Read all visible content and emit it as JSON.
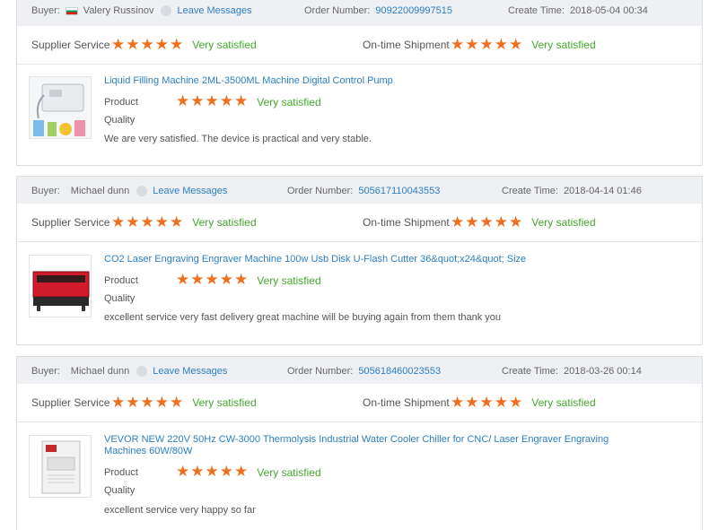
{
  "labels": {
    "buyer": "Buyer:",
    "leave_messages": "Leave Messages",
    "order_number": "Order Number:",
    "create_time": "Create Time:",
    "supplier_service": "Supplier Service",
    "ontime_shipment": "On-time Shipment",
    "product": "Product",
    "quality": "Quality",
    "very_satisfied": "Very satisfied"
  },
  "colors": {
    "star": "#f06f1e",
    "satisfied": "#43a82b",
    "link": "#2b7fc3",
    "header_bg": "#eef0f4"
  },
  "reviews": [
    {
      "buyer_name": "Valery Russinov",
      "buyer_badge_icon": "bulgaria-flag-icon",
      "order_number": "90922009997515",
      "create_time": "2018-05-04 00:34",
      "supplier_service_stars": 5,
      "ontime_shipment_stars": 5,
      "product_title": "Liquid Filling Machine 2ML-3500ML Machine Digital Control Pump",
      "product_stars": 5,
      "thumbnail_icon": "liquid-filling-machine-thumbnail",
      "comment": "We are very satisfied. The device is practical and very stable."
    },
    {
      "buyer_name": "Michael dunn",
      "buyer_badge_icon": "avatar-dot-icon",
      "order_number": "505617110043553",
      "create_time": "2018-04-14 01:46",
      "supplier_service_stars": 5,
      "ontime_shipment_stars": 5,
      "product_title": "CO2 Laser Engraving Engraver Machine 100w Usb Disk U-Flash Cutter 36&quot;x24&quot; Size",
      "product_stars": 5,
      "thumbnail_icon": "laser-engraver-thumbnail",
      "comment": "excellent service very fast delivery great machine will be buying again from them thank you"
    },
    {
      "buyer_name": "Michael dunn",
      "buyer_badge_icon": "avatar-dot-icon",
      "order_number": "505618460023553",
      "create_time": "2018-03-26 00:14",
      "supplier_service_stars": 5,
      "ontime_shipment_stars": 5,
      "product_title": "VEVOR NEW 220V 50Hz CW-3000 Thermolysis Industrial Water Cooler Chiller for CNC/ Laser Engraver Engraving Machines 60W/80W",
      "product_stars": 5,
      "thumbnail_icon": "water-chiller-thumbnail",
      "comment": "excellent service very happy so far"
    }
  ]
}
